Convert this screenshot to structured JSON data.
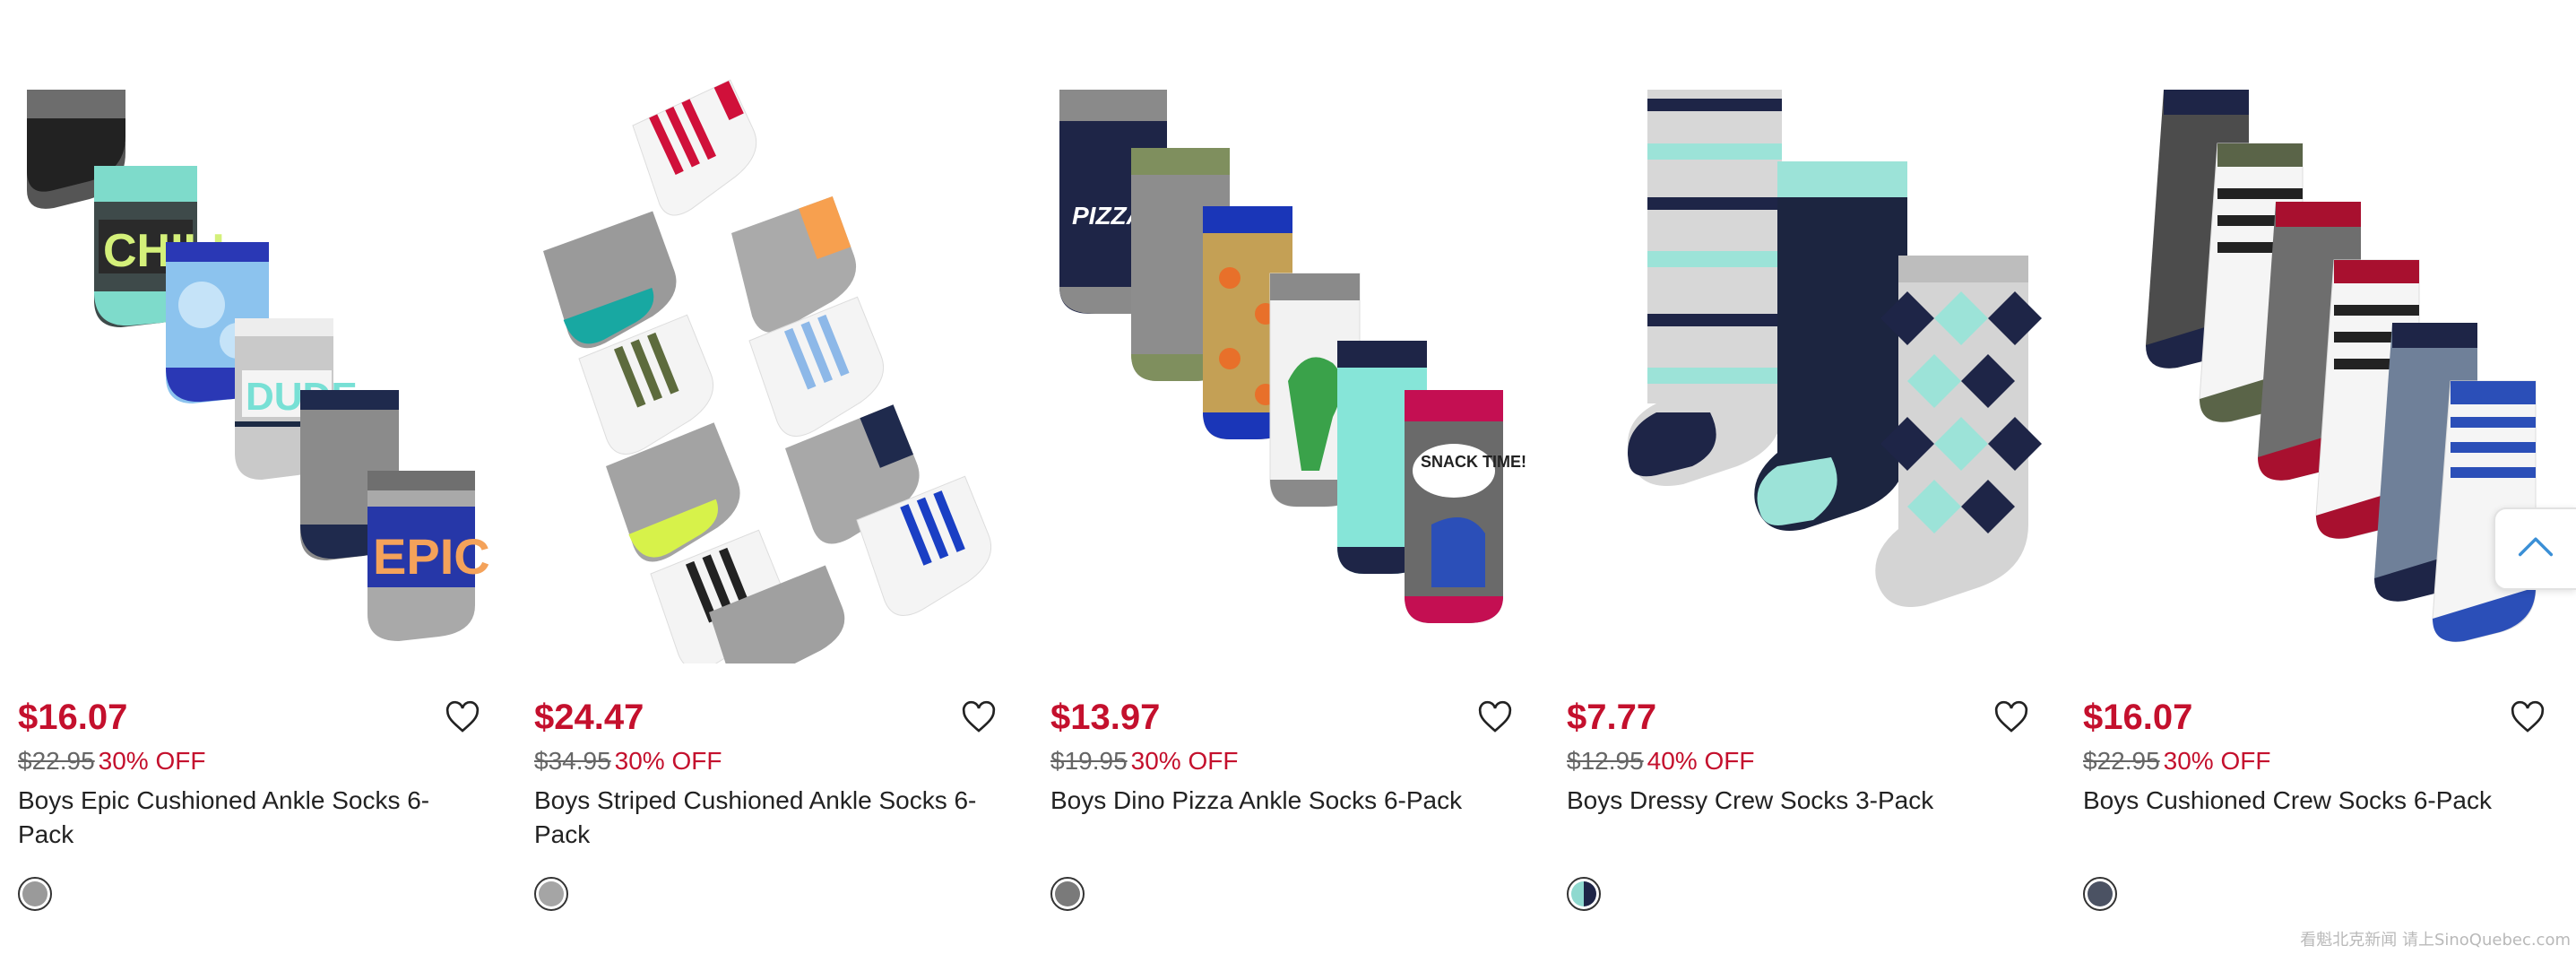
{
  "products": [
    {
      "price": "$16.07",
      "was_price": "$22.95",
      "discount": "30% OFF",
      "name": "Boys Epic Cushioned Ankle Socks 6-Pack",
      "swatch_color": "#9a9a9a",
      "image_labels": [
        "CHILL",
        "DUDE",
        "EPIC"
      ]
    },
    {
      "price": "$24.47",
      "was_price": "$34.95",
      "discount": "30% OFF",
      "name": "Boys Striped Cushioned Ankle Socks 6-Pack",
      "swatch_color": "#a5a5a5",
      "image_labels": []
    },
    {
      "price": "$13.97",
      "was_price": "$19.95",
      "discount": "30% OFF",
      "name": "Boys Dino Pizza Ankle Socks 6-Pack",
      "swatch_color": "#7a7a7a",
      "image_labels": [
        "PIZZA PARTY",
        "SNACK TIME!"
      ]
    },
    {
      "price": "$7.77",
      "was_price": "$12.95",
      "discount": "40% OFF",
      "name": "Boys Dressy Crew Socks 3-Pack",
      "swatch_color": "#8fd9cf",
      "image_labels": []
    },
    {
      "price": "$16.07",
      "was_price": "$22.95",
      "discount": "30% OFF",
      "name": "Boys Cushioned Crew Socks 6-Pack",
      "swatch_color": "#4b5263",
      "image_labels": []
    }
  ],
  "colors": {
    "accent": "#c4102d",
    "text": "#222222",
    "muted": "#666666"
  },
  "icons": {
    "favorite": "heart-outline-icon",
    "scroll": "chevron-up-icon"
  },
  "watermark": "看魁北克新闻 请上SinoQuebec.com"
}
